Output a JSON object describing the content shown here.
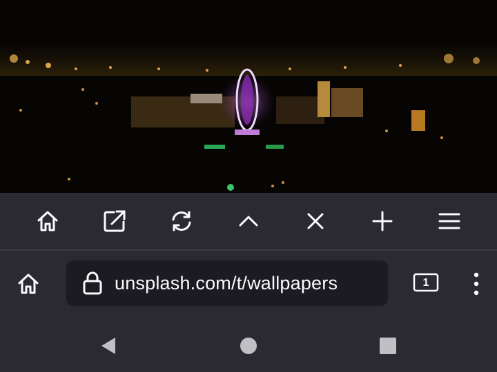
{
  "wallpaper": {
    "description_icon": "night-city-ferris-wheel-photo"
  },
  "toolbar": {
    "buttons": [
      {
        "icon": "home-icon"
      },
      {
        "icon": "open-external-icon"
      },
      {
        "icon": "refresh-icon"
      },
      {
        "icon": "chevron-up-icon"
      },
      {
        "icon": "close-icon"
      },
      {
        "icon": "plus-icon"
      },
      {
        "icon": "hamburger-menu-icon"
      }
    ]
  },
  "address_bar": {
    "url": "unsplash.com/t/wallpapers",
    "tab_count": "1"
  },
  "colors": {
    "chrome_bg": "#2b2a33",
    "url_bg": "#1c1b22",
    "icon": "#fbfbfe",
    "nav_icon": "#bfbfc4"
  }
}
